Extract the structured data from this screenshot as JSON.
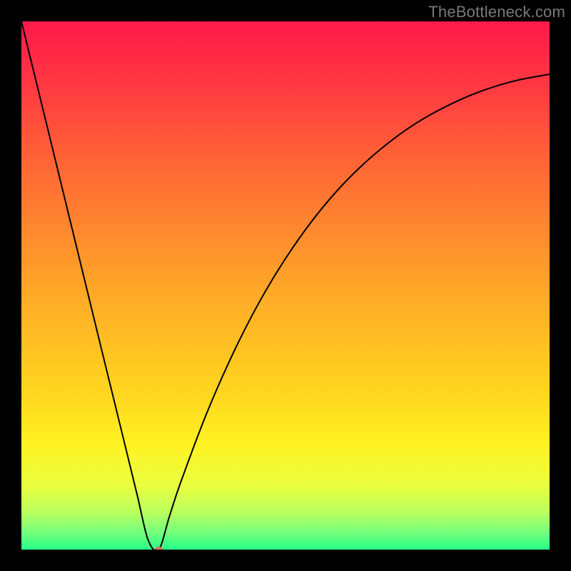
{
  "watermark": "TheBottleneck.com",
  "chart_data": {
    "type": "line",
    "title": "",
    "xlabel": "",
    "ylabel": "",
    "xlim": [
      0,
      100
    ],
    "ylim": [
      0,
      100
    ],
    "grid": false,
    "legend": false,
    "background_gradient": {
      "stops": [
        {
          "offset": 0.0,
          "color": "#ff1a4a"
        },
        {
          "offset": 0.12,
          "color": "#ff3842"
        },
        {
          "offset": 0.25,
          "color": "#ff6037"
        },
        {
          "offset": 0.4,
          "color": "#ff8a2e"
        },
        {
          "offset": 0.55,
          "color": "#ffb225"
        },
        {
          "offset": 0.7,
          "color": "#ffd51f"
        },
        {
          "offset": 0.8,
          "color": "#fff122"
        },
        {
          "offset": 0.88,
          "color": "#e9ff40"
        },
        {
          "offset": 0.93,
          "color": "#b9ff5e"
        },
        {
          "offset": 0.97,
          "color": "#6fff7d"
        },
        {
          "offset": 1.0,
          "color": "#26ff88"
        }
      ]
    },
    "series": [
      {
        "name": "bottleneck-curve",
        "color": "#000000",
        "width": 2,
        "x": [
          0,
          5,
          10,
          15,
          20,
          22,
          24,
          26,
          28,
          30,
          35,
          40,
          45,
          50,
          55,
          60,
          65,
          70,
          75,
          80,
          85,
          90,
          95,
          100
        ],
        "values": [
          100,
          79.6,
          59.1,
          38.6,
          18.2,
          10.0,
          1.8,
          0.0,
          6.2,
          12.3,
          25.6,
          37.0,
          46.8,
          55.1,
          62.2,
          68.2,
          73.2,
          77.4,
          80.9,
          83.7,
          86.0,
          87.8,
          89.1,
          90.0
        ]
      }
    ],
    "markers": [
      {
        "name": "optimum-marker",
        "x": 26,
        "y": 0,
        "rx": 6,
        "ry": 4,
        "color": "#d1745b"
      }
    ]
  }
}
